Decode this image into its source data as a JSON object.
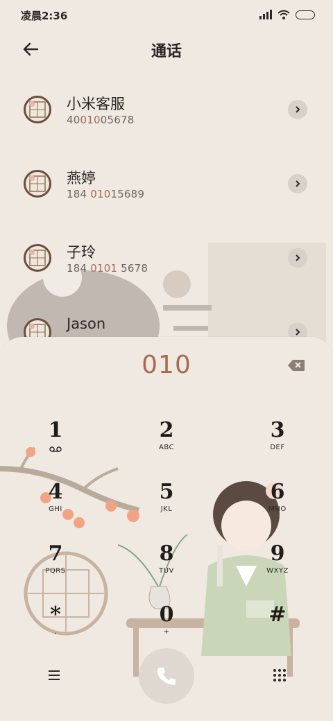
{
  "status_bar": {
    "time": "凌晨2:36"
  },
  "header": {
    "title": "通话"
  },
  "contacts": [
    {
      "name": "小米客服",
      "num_pre": "40",
      "num_hl": "010",
      "num_post": "05678"
    },
    {
      "name": "燕婷",
      "num_pre": "184 ",
      "num_hl": "010",
      "num_post": "15689"
    },
    {
      "name": "子玲",
      "num_pre": "184 ",
      "num_hl": "0101",
      "num_post": " 5678"
    },
    {
      "name": "Jason",
      "num_pre": "",
      "num_hl": "",
      "num_post": ""
    }
  ],
  "dialer": {
    "entered": "010",
    "keys": [
      {
        "digit": "1",
        "sub": ""
      },
      {
        "digit": "2",
        "sub": "ABC"
      },
      {
        "digit": "3",
        "sub": "DEF"
      },
      {
        "digit": "4",
        "sub": "GHI"
      },
      {
        "digit": "5",
        "sub": "JKL"
      },
      {
        "digit": "6",
        "sub": "MNO"
      },
      {
        "digit": "7",
        "sub": "PQRS"
      },
      {
        "digit": "8",
        "sub": "TUV"
      },
      {
        "digit": "9",
        "sub": "WXYZ"
      },
      {
        "digit": "*",
        "sub": ","
      },
      {
        "digit": "0",
        "sub": "+"
      },
      {
        "digit": "#",
        "sub": ""
      }
    ]
  },
  "icons": {
    "back": "back-arrow-icon",
    "chevron": "chevron-right-icon",
    "delete": "backspace-icon",
    "voicemail": "voicemail-icon",
    "menu": "menu-icon",
    "call": "phone-icon",
    "keypad_toggle": "dialpad-icon"
  },
  "colors": {
    "accent": "#a56a52",
    "background": "#efe9e2"
  }
}
